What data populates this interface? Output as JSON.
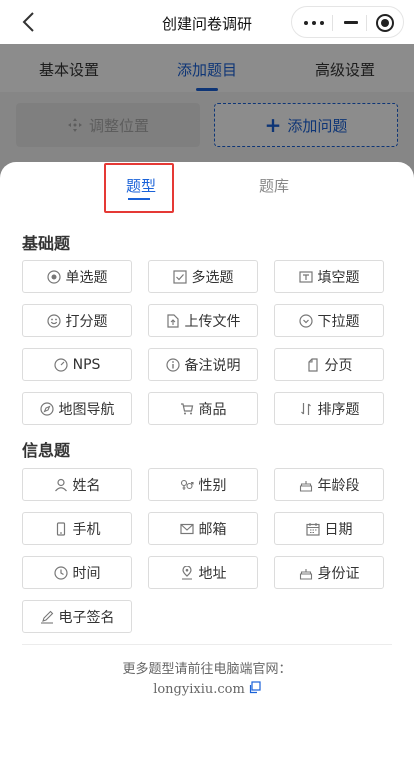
{
  "navbar": {
    "title": "创建问卷调研"
  },
  "background": {
    "tabs": [
      "基本设置",
      "添加题目",
      "高级设置"
    ],
    "adjust_label": "调整位置",
    "add_label": "添加问题"
  },
  "sheet": {
    "tabs": {
      "type": "题型",
      "bank": "题库"
    },
    "basic_title": "基础题",
    "basic": [
      "单选题",
      "多选题",
      "填空题",
      "打分题",
      "上传文件",
      "下拉题",
      "NPS",
      "备注说明",
      "分页",
      "地图导航",
      "商品",
      "排序题"
    ],
    "info_title": "信息题",
    "info": [
      "姓名",
      "性别",
      "年龄段",
      "手机",
      "邮箱",
      "日期",
      "时间",
      "地址",
      "身份证",
      "电子签名"
    ],
    "footer_text": "更多题型请前往电脑端官网：",
    "footer_link": "longyixiu.com"
  }
}
